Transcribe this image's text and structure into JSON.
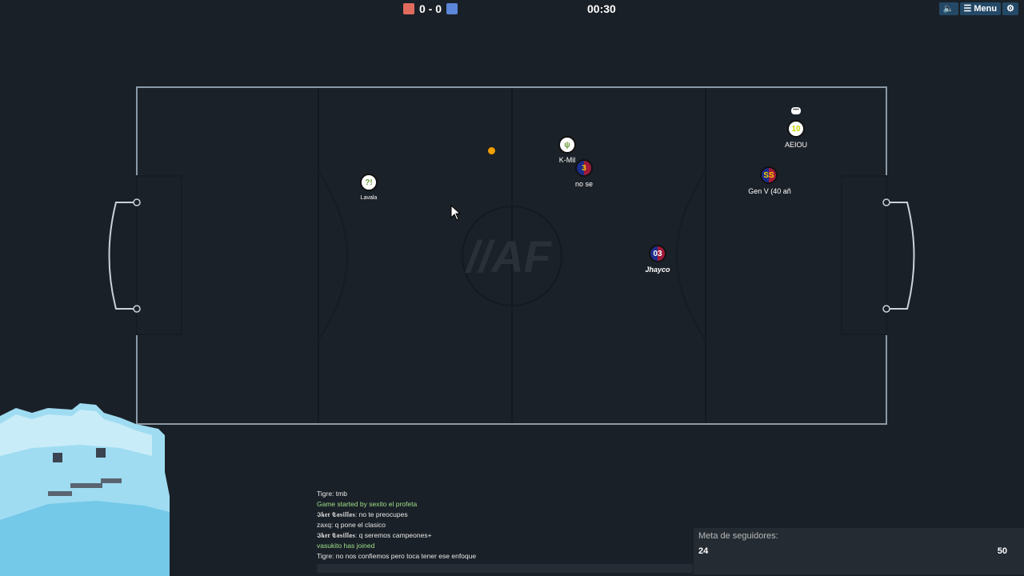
{
  "scoreboard": {
    "score": "0 - 0",
    "red_color": "#e06b5d",
    "blue_color": "#5b86d9",
    "timer": "00:30"
  },
  "top_buttons": {
    "sound": "🔈",
    "menu": "Menu",
    "settings": "⚙"
  },
  "field": {
    "logo": "//AF"
  },
  "players": [
    {
      "avatar": "?!",
      "name": "Lavala",
      "team": "red"
    },
    {
      "avatar": "ψ",
      "name": "K-Mil",
      "team": "red"
    },
    {
      "avatar": "3",
      "name": "no se",
      "team": "blue"
    },
    {
      "avatar": "10",
      "name": "AEIOU",
      "team": "red"
    },
    {
      "avatar": "SS",
      "name": "Gen V (40 añ",
      "team": "blue"
    },
    {
      "avatar": "03",
      "name": "Jhayco",
      "team": "blue"
    }
  ],
  "chat": [
    {
      "text": "Tigre: tmb",
      "type": "msg"
    },
    {
      "text": "Game started by sexito el profeta",
      "type": "notice"
    },
    {
      "text": "𝕴𝖐𝖊𝖗 𝕮𝖆𝖘𝖎𝖑𝖑𝖆𝖘: no te preocupes",
      "type": "msg"
    },
    {
      "text": "zaxq: q pone el clasico",
      "type": "msg"
    },
    {
      "text": "𝕴𝖐𝖊𝖗 𝕮𝖆𝖘𝖎𝖑𝖑𝖆𝖘: q seremos campeones+",
      "type": "msg"
    },
    {
      "text": "vasukito has joined",
      "type": "notice"
    },
    {
      "text": "Tigre: no nos confiemos pero toca tener ese enfoque",
      "type": "msg"
    }
  ],
  "followers_goal": {
    "title": "Meta de seguidores:",
    "current": "24",
    "target": "50"
  }
}
